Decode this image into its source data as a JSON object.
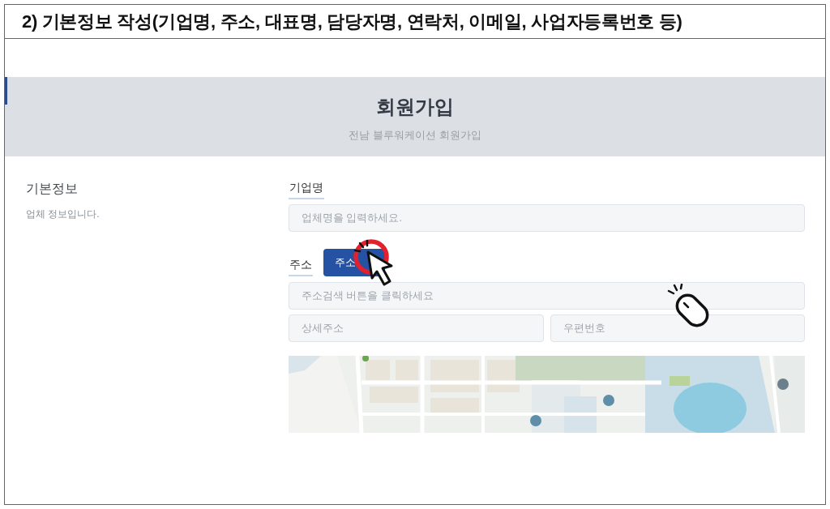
{
  "title_bar": {
    "title": "2) 기본정보 작성(기업명, 주소, 대표명, 담당자명, 연락처, 이메일, 사업자등록번호 등)"
  },
  "header": {
    "title": "회원가입",
    "subtitle": "전남 블루워케이션 회원가입"
  },
  "section": {
    "title": "기본정보",
    "description": "업체 정보입니다."
  },
  "company": {
    "label": "기업명",
    "placeholder": "업체명을 입력하세요."
  },
  "address": {
    "label": "주소",
    "button": "주소",
    "search_placeholder": "주소검색 버튼을 클릭하세요",
    "detail_fields": [
      {
        "placeholder": "상세주소"
      },
      {
        "placeholder": "우편번호"
      }
    ]
  }
}
